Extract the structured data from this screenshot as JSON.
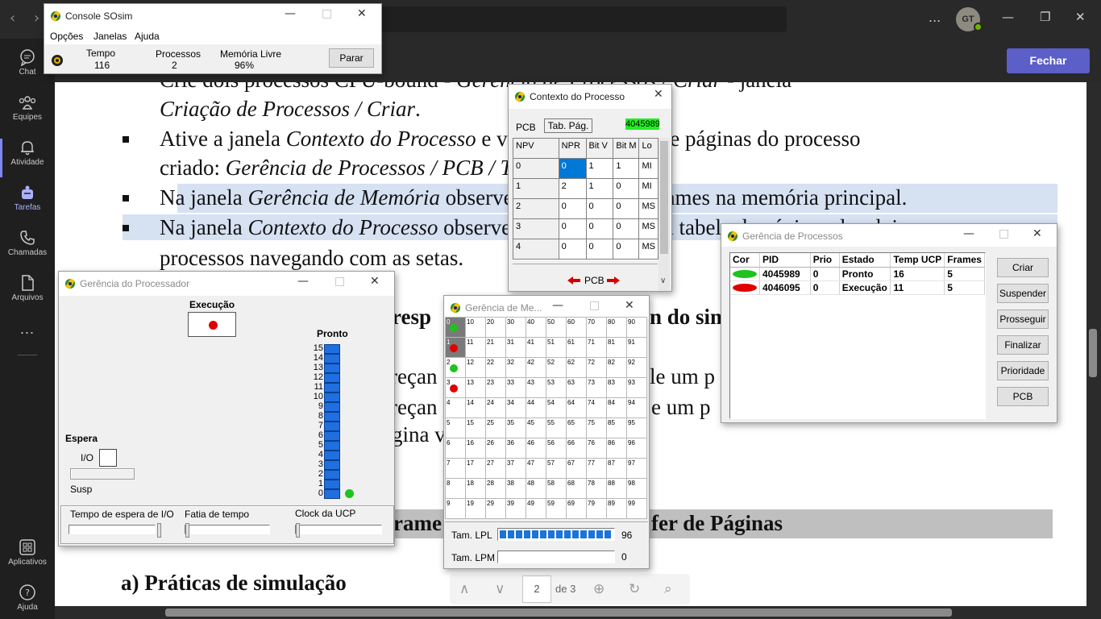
{
  "teams": {
    "rail": [
      {
        "label": "Chat"
      },
      {
        "label": "Equipes"
      },
      {
        "label": "Atividade"
      },
      {
        "label": "Tarefas"
      },
      {
        "label": "Chamadas"
      },
      {
        "label": "Arquivos"
      },
      {
        "label": "Aplicativos"
      },
      {
        "label": "Ajuda"
      }
    ],
    "more": "...",
    "avatar_initials": "GT",
    "close_button": "Fechar"
  },
  "document": {
    "lines": [
      {
        "pre": "Crie dois processos CPU-bound - ",
        "it": "Gerência de Processos / Criar",
        "post": " - janela"
      },
      {
        "pre": "",
        "it": "Criação de Processos / Criar",
        "post": "."
      },
      {
        "pre": "Ative a janela ",
        "it": "Contexto do Processo",
        "post": " e visualizar a tabela de páginas do processo"
      },
      {
        "pre": "criado: ",
        "it": "Gerência de Processos / PCB / Tab. de Pag",
        "post": "."
      },
      {
        "pre": "Na janela ",
        "it": "Gerência de Memória",
        "post": " observe a alocação dos frames na memória principal."
      },
      {
        "pre": "Na janela ",
        "it": "Contexto do Processo",
        "post": " observe as informações da tabela de páginas dos dois"
      },
      {
        "pre": "processos navegando com as setas.",
        "it": "",
        "post": ""
      }
    ],
    "frag1": "resp",
    "frag2": "n do sim",
    "frag3": "reçan",
    "frag4": "le um p",
    "frag5": "reçan",
    "frag6": "e um p",
    "frag7": "gina v",
    "heading_left": "rame",
    "heading_right": "fer de Páginas",
    "subheading": "a) Práticas de simulação",
    "pdf": {
      "page": "2",
      "of": "de 3"
    }
  },
  "console": {
    "title": "Console SOsim",
    "menu": [
      "Opções",
      "Janelas",
      "Ajuda"
    ],
    "tempo_label": "Tempo",
    "tempo_value": "116",
    "processos_label": "Processos",
    "processos_value": "2",
    "memoria_label": "Memória Livre",
    "memoria_value": "96%",
    "parar": "Parar"
  },
  "contexto": {
    "title": "Contexto do Processo",
    "tabs": [
      "PCB",
      "Tab. Pág."
    ],
    "pid_badge": "4045989",
    "headers": [
      "NPV",
      "NPR",
      "Bit V",
      "Bit M",
      "Lo"
    ],
    "rows": [
      [
        "0",
        "0",
        "1",
        "1",
        "MI"
      ],
      [
        "1",
        "2",
        "1",
        "0",
        "MI"
      ],
      [
        "2",
        "0",
        "0",
        "0",
        "MS"
      ],
      [
        "3",
        "0",
        "0",
        "0",
        "MS"
      ],
      [
        "4",
        "0",
        "0",
        "0",
        "MS"
      ]
    ],
    "nav_label": "PCB"
  },
  "processador": {
    "title": "Gerência do Processador",
    "execucao": "Execução",
    "pronto": "Pronto",
    "queue": [
      "15",
      "14",
      "13",
      "12",
      "11",
      "10",
      "9",
      "8",
      "7",
      "6",
      "5",
      "4",
      "3",
      "2",
      "1",
      "0"
    ],
    "espera": "Espera",
    "io": "I/O",
    "susp": "Susp",
    "tempo_espera": "Tempo de espera de I/O",
    "fatia": "Fatia de tempo",
    "clock": "Clock da UCP",
    "colors": {
      "exec_dot": "#e00000",
      "ready_dot": "#1ec31e",
      "queue": "#1f6fe0"
    }
  },
  "memoria": {
    "title": "Gerência de Me...",
    "cells": [
      [
        "0",
        "10",
        "20",
        "30",
        "40",
        "50",
        "60",
        "70",
        "80",
        "90"
      ],
      [
        "1",
        "11",
        "21",
        "31",
        "41",
        "51",
        "61",
        "71",
        "81",
        "91"
      ],
      [
        "2",
        "12",
        "22",
        "32",
        "42",
        "52",
        "62",
        "72",
        "82",
        "92"
      ],
      [
        "3",
        "13",
        "23",
        "33",
        "43",
        "53",
        "63",
        "73",
        "83",
        "93"
      ],
      [
        "4",
        "14",
        "24",
        "34",
        "44",
        "54",
        "64",
        "74",
        "84",
        "94"
      ],
      [
        "5",
        "15",
        "25",
        "35",
        "45",
        "55",
        "65",
        "75",
        "85",
        "95"
      ],
      [
        "6",
        "16",
        "26",
        "36",
        "46",
        "56",
        "66",
        "76",
        "86",
        "96"
      ],
      [
        "7",
        "17",
        "27",
        "37",
        "47",
        "57",
        "67",
        "77",
        "87",
        "97"
      ],
      [
        "8",
        "18",
        "28",
        "38",
        "48",
        "58",
        "68",
        "78",
        "88",
        "98"
      ],
      [
        "9",
        "19",
        "29",
        "39",
        "49",
        "59",
        "69",
        "79",
        "89",
        "99"
      ]
    ],
    "frame_dots": [
      {
        "frame": 0,
        "color": "#1ec31e"
      },
      {
        "frame": 1,
        "color": "#e00000"
      },
      {
        "frame": 2,
        "color": "#1ec31e"
      },
      {
        "frame": 3,
        "color": "#e00000"
      }
    ],
    "lpl_label": "Tam. LPL",
    "lpl_value": "96",
    "lpm_label": "Tam. LPM",
    "lpm_value": "0",
    "lpl_fill": 1.0
  },
  "processos": {
    "title": "Gerência de Processos",
    "headers": [
      "Cor",
      "PID",
      "Prio",
      "Estado",
      "Temp UCP",
      "Frames"
    ],
    "rows": [
      {
        "color": "#1ec31e",
        "pid": "4045989",
        "prio": "0",
        "estado": "Pronto",
        "temp": "16",
        "frames": "5"
      },
      {
        "color": "#e00000",
        "pid": "4046095",
        "prio": "0",
        "estado": "Execução",
        "temp": "11",
        "frames": "5"
      }
    ],
    "buttons": [
      "Criar",
      "Suspender",
      "Prosseguir",
      "Finalizar",
      "Prioridade",
      "PCB"
    ]
  }
}
